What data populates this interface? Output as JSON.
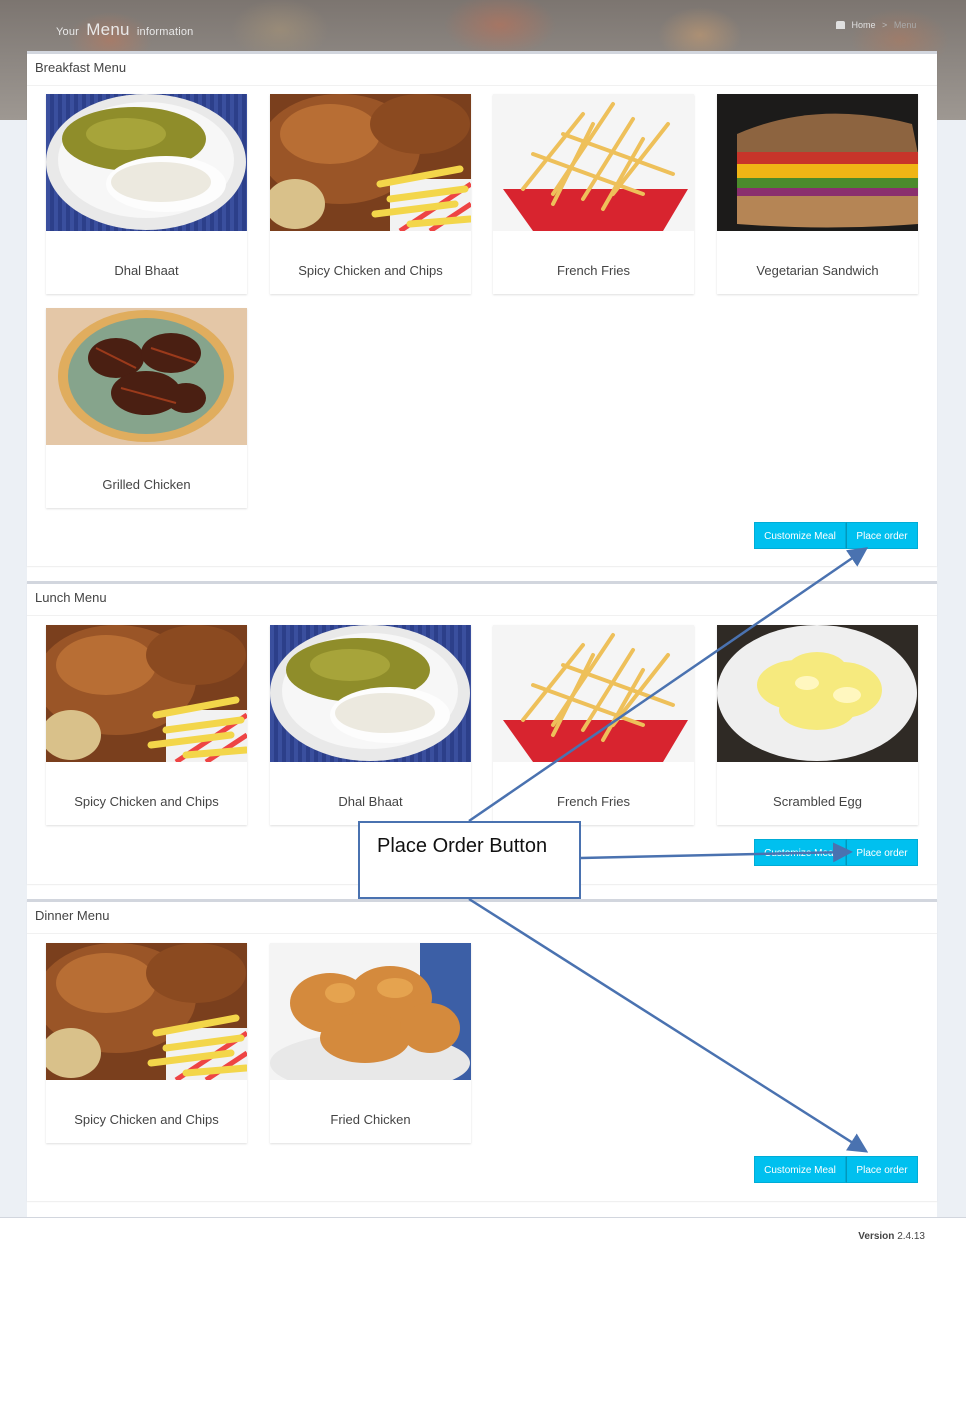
{
  "header": {
    "brand_prefix": "Your",
    "brand_main": "Menu",
    "brand_suffix": "information",
    "breadcrumb": [
      "Home",
      "Menu"
    ]
  },
  "sections": [
    {
      "title": "Breakfast Menu",
      "items": [
        "Dhal Bhaat",
        "Spicy Chicken and Chips",
        "French Fries",
        "Vegetarian Sandwich",
        "Grilled Chicken"
      ],
      "customize_label": "Customize Meal",
      "order_label": "Place order"
    },
    {
      "title": "Lunch Menu",
      "items": [
        "Spicy Chicken and Chips",
        "Dhal Bhaat",
        "French Fries",
        "Scrambled Egg"
      ],
      "customize_label": "Customize Meal",
      "order_label": "Place order"
    },
    {
      "title": "Dinner Menu",
      "items": [
        "Spicy Chicken and Chips",
        "Fried Chicken"
      ],
      "customize_label": "Customize Meal",
      "order_label": "Place order"
    }
  ],
  "annotation": {
    "text": "Place Order Button"
  },
  "footer": {
    "version_label": "Version",
    "version_number": "2.4.13"
  },
  "colors": {
    "button": "#00c0ef",
    "annotation": "#4a72b0",
    "page_bg": "#ecf0f5"
  }
}
